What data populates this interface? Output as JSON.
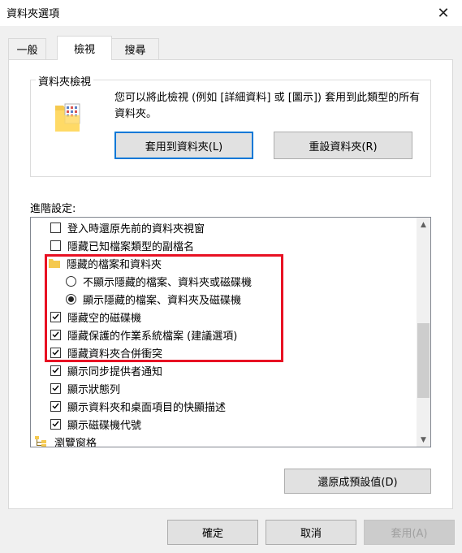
{
  "window": {
    "title": "資料夾選項",
    "close_glyph": "✕"
  },
  "tabs": [
    {
      "label": "一般",
      "active": false
    },
    {
      "label": "檢視",
      "active": true
    },
    {
      "label": "搜尋",
      "active": false
    }
  ],
  "folder_views": {
    "legend": "資料夾檢視",
    "description": "您可以將此檢視 (例如 [詳細資料] 或 [圖示]) 套用到此類型的所有資料夾。",
    "apply_button": "套用到資料夾(L)",
    "reset_button": "重設資料夾(R)"
  },
  "advanced": {
    "label": "進階設定:",
    "items": [
      {
        "type": "checkbox",
        "checked": false,
        "label": "登入時還原先前的資料夾視窗"
      },
      {
        "type": "checkbox",
        "checked": false,
        "label": "隱藏已知檔案類型的副檔名"
      },
      {
        "type": "folder",
        "label": "隱藏的檔案和資料夾"
      },
      {
        "type": "radio",
        "checked": false,
        "label": "不顯示隱藏的檔案、資料夾或磁碟機"
      },
      {
        "type": "radio",
        "checked": true,
        "label": "顯示隱藏的檔案、資料夾及磁碟機"
      },
      {
        "type": "checkbox",
        "checked": true,
        "label": "隱藏空的磁碟機"
      },
      {
        "type": "checkbox",
        "checked": true,
        "label": "隱藏保護的作業系統檔案 (建議選項)"
      },
      {
        "type": "checkbox",
        "checked": true,
        "label": "隱藏資料夾合併衝突"
      },
      {
        "type": "checkbox",
        "checked": true,
        "label": "顯示同步提供者通知"
      },
      {
        "type": "checkbox",
        "checked": true,
        "label": "顯示狀態列"
      },
      {
        "type": "checkbox",
        "checked": true,
        "label": "顯示資料夾和桌面項目的快顯描述"
      },
      {
        "type": "checkbox",
        "checked": true,
        "label": "顯示磁碟機代號"
      },
      {
        "type": "pane",
        "label": "瀏覽窗格"
      }
    ],
    "restore_button": "還原成預設值(D)"
  },
  "footer": {
    "ok": "確定",
    "cancel": "取消",
    "apply": "套用(A)",
    "apply_enabled": false
  },
  "colors": {
    "highlight": "#e81123",
    "accent": "#0078d7",
    "folder": "#f5c94f"
  }
}
